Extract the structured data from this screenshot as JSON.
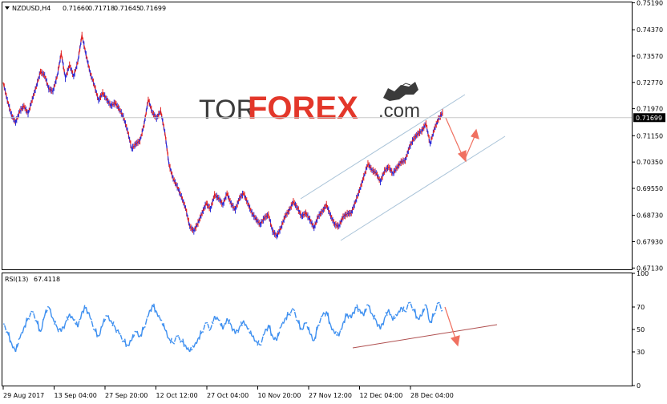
{
  "chart_data": [
    {
      "type": "line",
      "symbol": "NZDUSD,H4",
      "ohlc": [
        "0.71660",
        "0.71718",
        "0.71645",
        "0.71699"
      ],
      "current_price": "0.71699",
      "ylim": [
        0.6709,
        0.752
      ],
      "y_ticks": [
        "0.75190",
        "0.74370",
        "0.73570",
        "0.72770",
        "0.71970",
        "0.71150",
        "0.70350",
        "0.69550",
        "0.68730",
        "0.67930",
        "0.67130"
      ],
      "x_ticks": [
        "29 Aug 2017",
        "13 Sep 04:00",
        "27 Sep 20:00",
        "12 Oct 12:00",
        "27 Oct 04:00",
        "10 Nov 20:00",
        "27 Nov 12:00",
        "12 Dec 04:00",
        "28 Dec 04:00"
      ],
      "up_color": "#2a2ad6",
      "down_color": "#e01f1f",
      "series": [
        {
          "values": [
            0.7277,
            0.7222,
            0.7178,
            0.7155,
            0.719,
            0.7205,
            0.7182,
            0.7225,
            0.7265,
            0.731,
            0.7298,
            0.7258,
            0.725,
            0.7295,
            0.7365,
            0.729,
            0.733,
            0.7295,
            0.734,
            0.742,
            0.736,
            0.7305,
            0.7268,
            0.7222,
            0.7245,
            0.7225,
            0.7206,
            0.7215,
            0.7196,
            0.7172,
            0.713,
            0.7075,
            0.709,
            0.71,
            0.715,
            0.7225,
            0.7185,
            0.7168,
            0.719,
            0.7125,
            0.7028,
            0.6985,
            0.696,
            0.693,
            0.6895,
            0.684,
            0.6825,
            0.685,
            0.688,
            0.691,
            0.6892,
            0.6935,
            0.6925,
            0.6905,
            0.694,
            0.6908,
            0.689,
            0.6925,
            0.694,
            0.691,
            0.688,
            0.6862,
            0.6845,
            0.6865,
            0.6875,
            0.6825,
            0.681,
            0.6835,
            0.687,
            0.6888,
            0.6915,
            0.6895,
            0.687,
            0.688,
            0.686,
            0.6835,
            0.687,
            0.6885,
            0.6905,
            0.6872,
            0.6845,
            0.684,
            0.6868,
            0.6878,
            0.688,
            0.6915,
            0.695,
            0.699,
            0.703,
            0.701,
            0.7002,
            0.6975,
            0.7008,
            0.702,
            0.7,
            0.7018,
            0.7035,
            0.704,
            0.708,
            0.7105,
            0.712,
            0.713,
            0.7152,
            0.709,
            0.7134,
            0.7165,
            0.7185
          ]
        }
      ],
      "annotations": [
        "ascending channel",
        "arrow down then up"
      ]
    },
    {
      "type": "line",
      "indicator": "RSI(13)",
      "current_value": "67.4118",
      "ylim": [
        0,
        100
      ],
      "y_ticks": [
        "100",
        "70",
        "50",
        "30",
        "0"
      ],
      "line_color": "#3d8ff0",
      "series": [
        {
          "values": [
            55,
            48,
            38,
            30,
            42,
            52,
            60,
            66,
            58,
            48,
            62,
            70,
            60,
            52,
            48,
            56,
            64,
            58,
            52,
            66,
            70,
            60,
            50,
            44,
            54,
            62,
            58,
            52,
            46,
            40,
            36,
            40,
            48,
            44,
            52,
            62,
            72,
            66,
            58,
            50,
            42,
            38,
            44,
            40,
            36,
            30,
            34,
            42,
            48,
            56,
            50,
            62,
            58,
            50,
            60,
            54,
            46,
            52,
            58,
            50,
            44,
            40,
            36,
            46,
            54,
            44,
            40,
            52,
            60,
            64,
            68,
            58,
            50,
            56,
            46,
            40,
            54,
            62,
            66,
            54,
            46,
            44,
            56,
            64,
            60,
            70,
            68,
            62,
            72,
            64,
            58,
            50,
            60,
            68,
            58,
            62,
            70,
            66,
            74,
            68,
            60,
            62,
            72,
            56,
            64,
            74,
            67
          ]
        }
      ],
      "annotations": [
        "rising support line",
        "arrow down"
      ]
    }
  ],
  "logo": {
    "tor": "TOR",
    "forex": "FOREX",
    "com": ".com"
  }
}
